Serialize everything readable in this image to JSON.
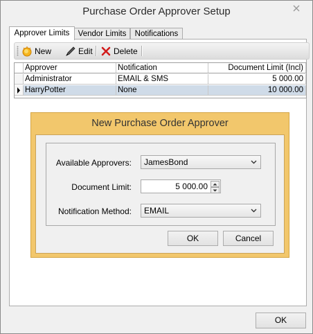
{
  "window": {
    "title": "Purchase Order Approver Setup"
  },
  "tabs": [
    "Approver Limits",
    "Vendor Limits",
    "Notifications"
  ],
  "toolbar": {
    "new_label": "New",
    "edit_label": "Edit",
    "delete_label": "Delete"
  },
  "grid": {
    "columns": [
      "Approver",
      "Notification",
      "Document Limit (Incl)"
    ],
    "rows": [
      {
        "approver": "Administrator",
        "notification": "EMAIL & SMS",
        "limit": "5 000.00"
      },
      {
        "approver": "HarryPotter",
        "notification": "None",
        "limit": "10 000.00"
      }
    ]
  },
  "dialog": {
    "title": "New Purchase Order Approver",
    "available_label": "Available Approvers:",
    "available_value": "JamesBond",
    "limit_label": "Document Limit:",
    "limit_value": "5 000.00",
    "method_label": "Notification Method:",
    "method_value": "EMAIL",
    "ok_label": "OK",
    "cancel_label": "Cancel"
  },
  "footer": {
    "ok_label": "OK"
  },
  "colors": {
    "dialog_frame": "#f2c76c",
    "selected_row": "#cfdbe8"
  }
}
